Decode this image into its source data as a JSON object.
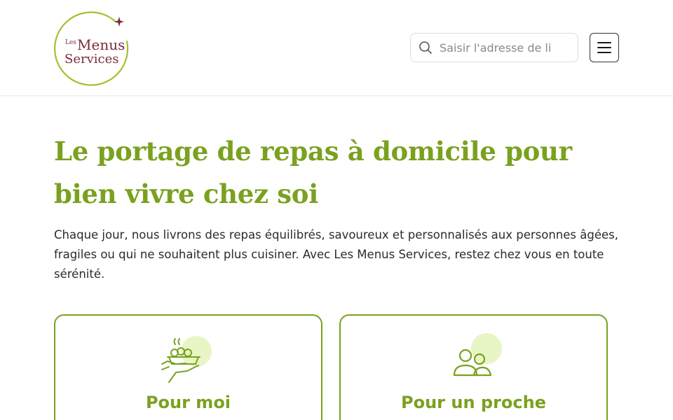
{
  "header": {
    "logo": {
      "les": "Les",
      "menus": "Menus",
      "services": "Services",
      "colors": {
        "ring": "#a3c12b",
        "text": "#7a2b3a",
        "star": "#7a2b3a"
      }
    },
    "search": {
      "placeholder": "Saisir l'adresse de li",
      "value": "",
      "icon": "search-icon"
    },
    "menu": {
      "icon": "hamburger-menu-icon"
    }
  },
  "hero": {
    "title": "Le portage de repas à domicile pour bien vivre chez soi",
    "text": "Chaque jour, nous livrons des repas équilibrés, savoureux et personnalisés aux personnes âgées, fragiles ou qui ne souhaitent plus cuisiner. Avec Les Menus Services, restez chez vous en toute sérénité."
  },
  "cards": [
    {
      "title": "Pour moi",
      "icon": "meal-tray-hand-icon"
    },
    {
      "title": "Pour un proche",
      "icon": "two-people-icon"
    }
  ],
  "colors": {
    "brand_green": "#7aa11f",
    "icon_blob": "#e8f5c4",
    "burgundy": "#7a2b3a"
  }
}
